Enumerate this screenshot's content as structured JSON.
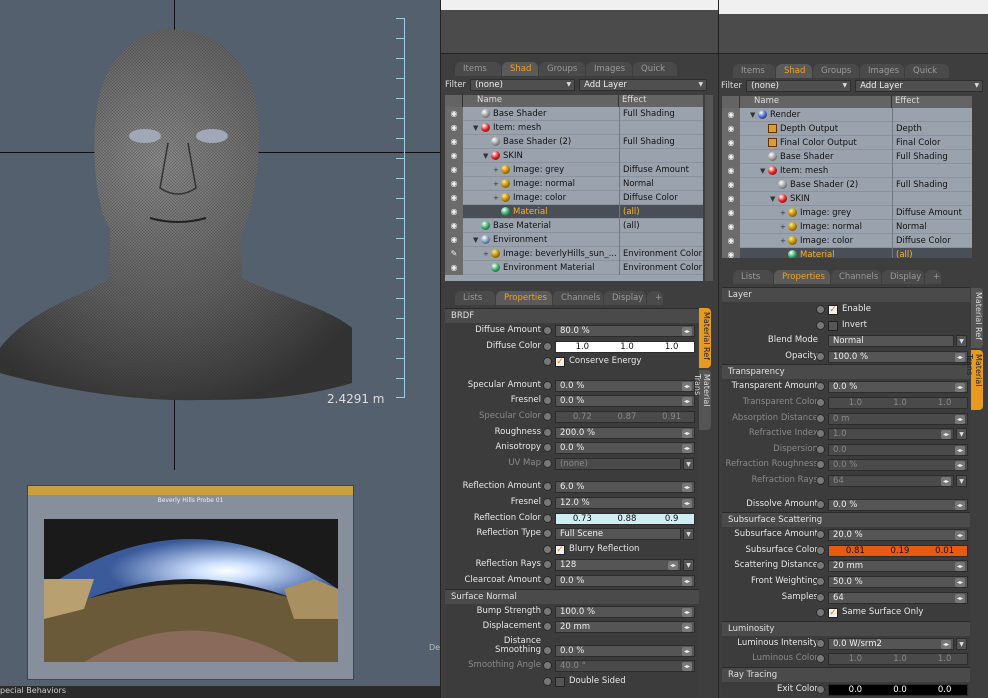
{
  "viewport": {
    "dimension_label": "2.4291 m",
    "probe_title": "Beverly Hills Probe 01",
    "status_text": "pecial Behaviors",
    "side_text": "De"
  },
  "left_panel": {
    "tabs": [
      "Items",
      "Shad ...",
      "Groups",
      "Images",
      "Quick ..."
    ],
    "filter_label": "Filter",
    "filter_value": "(none)",
    "add_layer": "Add Layer",
    "tree_cols": {
      "name": "Name",
      "effect": "Effect"
    },
    "tree": [
      {
        "indent": 1,
        "tw": "",
        "icon": "ball",
        "name": "Base Shader",
        "effect": "Full Shading"
      },
      {
        "indent": 1,
        "tw": "▼",
        "icon": "red",
        "name": "Item: mesh",
        "effect": ""
      },
      {
        "indent": 2,
        "tw": "",
        "icon": "ball",
        "name": "Base Shader (2)",
        "effect": "Full Shading"
      },
      {
        "indent": 2,
        "tw": "▼",
        "icon": "red",
        "name": "SKIN",
        "effect": ""
      },
      {
        "indent": 3,
        "tw": "+",
        "icon": "img",
        "name": "Image: grey",
        "effect": "Diffuse Amount"
      },
      {
        "indent": 3,
        "tw": "+",
        "icon": "img",
        "name": "Image: normal",
        "effect": "Normal"
      },
      {
        "indent": 3,
        "tw": "+",
        "icon": "img",
        "name": "Image: color",
        "effect": "Diffuse Color"
      },
      {
        "indent": 3,
        "tw": "",
        "icon": "grn",
        "name": "Material",
        "effect": "(all)",
        "selected": true
      },
      {
        "indent": 1,
        "tw": "",
        "icon": "grn",
        "name": "Base Material",
        "effect": "(all)"
      },
      {
        "indent": 1,
        "tw": "▼",
        "icon": "env",
        "name": "Environment",
        "effect": ""
      },
      {
        "indent": 2,
        "tw": "+",
        "icon": "img",
        "name": "Image: beverlyHills_sun_...",
        "effect": "Environment Color",
        "brush": true
      },
      {
        "indent": 2,
        "tw": "",
        "icon": "grn",
        "name": "Environment Material",
        "effect": "Environment Color"
      }
    ],
    "prop_tabs": [
      "Lists",
      "Properties",
      "Channels",
      "Display",
      "+"
    ],
    "side_tabs": [
      "Material Ref",
      "Material Trans"
    ],
    "sections": [
      {
        "title": "BRDF",
        "rows": [
          {
            "label": "Diffuse Amount",
            "value": "80.0 %",
            "spin": true
          },
          {
            "label": "Diffuse Color",
            "color": [
              "1.0",
              "1.0",
              "1.0"
            ],
            "bg": "#ffffff"
          },
          {
            "check": "Conserve Energy",
            "on": true
          },
          {
            "gap": true
          },
          {
            "label": "Specular Amount",
            "value": "0.0 %",
            "spin": true
          },
          {
            "label": "Fresnel",
            "value": "0.0 %",
            "spin": true
          },
          {
            "label": "Specular Color",
            "color": [
              "0.72",
              "0.87",
              "0.91"
            ],
            "dim": true
          },
          {
            "label": "Roughness",
            "value": "200.0 %",
            "spin": true
          },
          {
            "label": "Anisotropy",
            "value": "0.0 %",
            "spin": true
          },
          {
            "label": "UV Map",
            "value": "(none)",
            "dim": true,
            "dd": true
          },
          {
            "gap": true
          },
          {
            "label": "Reflection Amount",
            "value": "6.0 %",
            "spin": true
          },
          {
            "label": "Fresnel",
            "value": "12.0 %",
            "spin": true
          },
          {
            "label": "Reflection Color",
            "color": [
              "0.73",
              "0.88",
              "0.9"
            ],
            "bg": "#cfeef0"
          },
          {
            "label": "Reflection Type",
            "value": "Full Scene",
            "dd": true
          },
          {
            "check": "Blurry Reflection",
            "on": true
          },
          {
            "label": "Reflection Rays",
            "value": "128",
            "spin": true,
            "dd": true
          },
          {
            "label": "Clearcoat Amount",
            "value": "0.0 %",
            "spin": true
          }
        ]
      },
      {
        "title": "Surface Normal",
        "rows": [
          {
            "label": "Bump Strength",
            "value": "100.0 %",
            "spin": true
          },
          {
            "label": "Displacement Distance",
            "value": "20 mm",
            "spin": true
          },
          {
            "gap": true
          },
          {
            "label": "Smoothing",
            "value": "0.0 %",
            "spin": true
          },
          {
            "label": "Smoothing Angle",
            "value": "40.0 °",
            "spin": true,
            "dim": true
          },
          {
            "check": "Double Sided",
            "on": false
          }
        ]
      }
    ]
  },
  "right_panel": {
    "tabs": [
      "Items",
      "Shad ...",
      "Groups",
      "Images",
      "Quick ..."
    ],
    "filter_label": "Filter",
    "filter_value": "(none)",
    "add_layer": "Add Layer",
    "tree_cols": {
      "name": "Name",
      "effect": "Effect"
    },
    "tree": [
      {
        "indent": 1,
        "tw": "▼",
        "icon": "blu",
        "name": "Render",
        "effect": ""
      },
      {
        "indent": 2,
        "tw": "",
        "icon": "sq",
        "name": "Depth Output",
        "effect": "Depth"
      },
      {
        "indent": 2,
        "tw": "",
        "icon": "sq",
        "name": "Final Color Output",
        "effect": "Final Color"
      },
      {
        "indent": 2,
        "tw": "",
        "icon": "ball",
        "name": "Base Shader",
        "effect": "Full Shading"
      },
      {
        "indent": 2,
        "tw": "▼",
        "icon": "red",
        "name": "Item: mesh",
        "effect": ""
      },
      {
        "indent": 3,
        "tw": "",
        "icon": "ball",
        "name": "Base Shader (2)",
        "effect": "Full Shading"
      },
      {
        "indent": 3,
        "tw": "▼",
        "icon": "red",
        "name": "SKIN",
        "effect": ""
      },
      {
        "indent": 4,
        "tw": "+",
        "icon": "img",
        "name": "Image: grey",
        "effect": "Diffuse Amount"
      },
      {
        "indent": 4,
        "tw": "+",
        "icon": "img",
        "name": "Image: normal",
        "effect": "Normal"
      },
      {
        "indent": 4,
        "tw": "+",
        "icon": "img",
        "name": "Image: color",
        "effect": "Diffuse Color"
      },
      {
        "indent": 4,
        "tw": "",
        "icon": "grn",
        "name": "Material",
        "effect": "(all)",
        "selected": true
      }
    ],
    "prop_tabs": [
      "Lists",
      "Properties",
      "Channels",
      "Display",
      "+"
    ],
    "side_tabs": [
      "Material Ref",
      "Material Trans"
    ],
    "sections": [
      {
        "title": "Layer",
        "rows": [
          {
            "check": "Enable",
            "on": true
          },
          {
            "check": "Invert",
            "on": false
          },
          {
            "label": "Blend Mode",
            "value": "Normal",
            "dd": true,
            "nodot": true
          },
          {
            "label": "Opacity",
            "value": "100.0 %",
            "spin": true
          }
        ]
      },
      {
        "title": "Transparency",
        "rows": [
          {
            "label": "Transparent Amount",
            "value": "0.0 %",
            "spin": true
          },
          {
            "label": "Transparent Color",
            "color": [
              "1.0",
              "1.0",
              "1.0"
            ],
            "dim": true
          },
          {
            "label": "Absorption Distance",
            "value": "0 m",
            "spin": true,
            "dim": true
          },
          {
            "label": "Refractive Index",
            "value": "1.0",
            "spin": true,
            "dim": true,
            "dd": true
          },
          {
            "label": "Dispersion",
            "value": "0.0",
            "spin": true,
            "dim": true
          },
          {
            "label": "Refraction Roughness",
            "value": "0.0 %",
            "spin": true,
            "dim": true
          },
          {
            "label": "Refraction Rays",
            "value": "64",
            "spin": true,
            "dim": true,
            "dd": true
          },
          {
            "gap": true
          },
          {
            "label": "Dissolve Amount",
            "value": "0.0 %",
            "spin": true
          }
        ]
      },
      {
        "title": "Subsurface Scattering",
        "rows": [
          {
            "label": "Subsurface Amount",
            "value": "20.0 %",
            "spin": true
          },
          {
            "label": "Subsurface Color",
            "color": [
              "0.81",
              "0.19",
              "0.01"
            ],
            "bg": "#e85a10"
          },
          {
            "label": "Scattering Distance",
            "value": "20 mm",
            "spin": true
          },
          {
            "label": "Front Weighting",
            "value": "50.0 %",
            "spin": true
          },
          {
            "label": "Samples",
            "value": "64",
            "spin": true
          },
          {
            "check": "Same Surface Only",
            "on": true
          }
        ]
      },
      {
        "title": "Luminosity",
        "rows": [
          {
            "label": "Luminous Intensity",
            "value": "0.0 W/srm2",
            "spin": true,
            "dd": true
          },
          {
            "label": "Luminous Color",
            "color": [
              "1.0",
              "1.0",
              "1.0"
            ],
            "dim": true
          }
        ]
      },
      {
        "title": "Ray Tracing",
        "rows": [
          {
            "label": "Exit Color",
            "color": [
              "0.0",
              "0.0",
              "0.0"
            ],
            "bg": "#000000",
            "light": true
          }
        ]
      }
    ]
  }
}
